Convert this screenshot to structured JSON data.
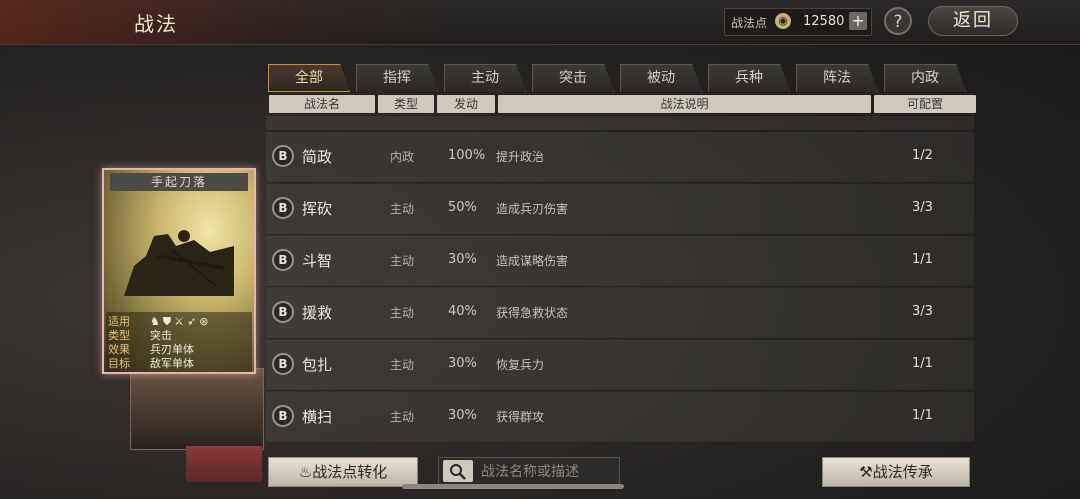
{
  "header": {
    "title": "战法",
    "points_label": "战法点",
    "points_value": "12580",
    "plus_label": "+",
    "help_label": "?",
    "back_label": "返回"
  },
  "tabs": [
    {
      "label": "全部",
      "active": true
    },
    {
      "label": "指挥"
    },
    {
      "label": "主动"
    },
    {
      "label": "突击"
    },
    {
      "label": "被动"
    },
    {
      "label": "兵种"
    },
    {
      "label": "阵法"
    },
    {
      "label": "内政"
    }
  ],
  "columns": {
    "name": "战法名",
    "type": "类型",
    "rate": "发动",
    "desc": "战法说明",
    "config": "可配置"
  },
  "rows": [
    {
      "grade": "B",
      "name": "简政",
      "type": "内政",
      "rate": "100%",
      "desc": "提升政治",
      "config": "1/2"
    },
    {
      "grade": "B",
      "name": "挥砍",
      "type": "主动",
      "rate": "50%",
      "desc": "造成兵刃伤害",
      "config": "3/3"
    },
    {
      "grade": "B",
      "name": "斗智",
      "type": "主动",
      "rate": "30%",
      "desc": "造成谋略伤害",
      "config": "1/1"
    },
    {
      "grade": "B",
      "name": "援救",
      "type": "主动",
      "rate": "40%",
      "desc": "获得急救状态",
      "config": "3/3"
    },
    {
      "grade": "B",
      "name": "包扎",
      "type": "主动",
      "rate": "30%",
      "desc": "恢复兵力",
      "config": "1/1"
    },
    {
      "grade": "B",
      "name": "横扫",
      "type": "主动",
      "rate": "30%",
      "desc": "获得群攻",
      "config": "1/1"
    }
  ],
  "card": {
    "title": "手起刀落",
    "info": [
      {
        "key": "适用",
        "value": ""
      },
      {
        "key": "类型",
        "value": "突击"
      },
      {
        "key": "效果",
        "value": "兵刃单体"
      },
      {
        "key": "目标",
        "value": "敌军单体"
      }
    ]
  },
  "bottom": {
    "convert_label": "战法点转化",
    "search_placeholder": "战法名称或描述",
    "inherit_label": "战法传承"
  }
}
